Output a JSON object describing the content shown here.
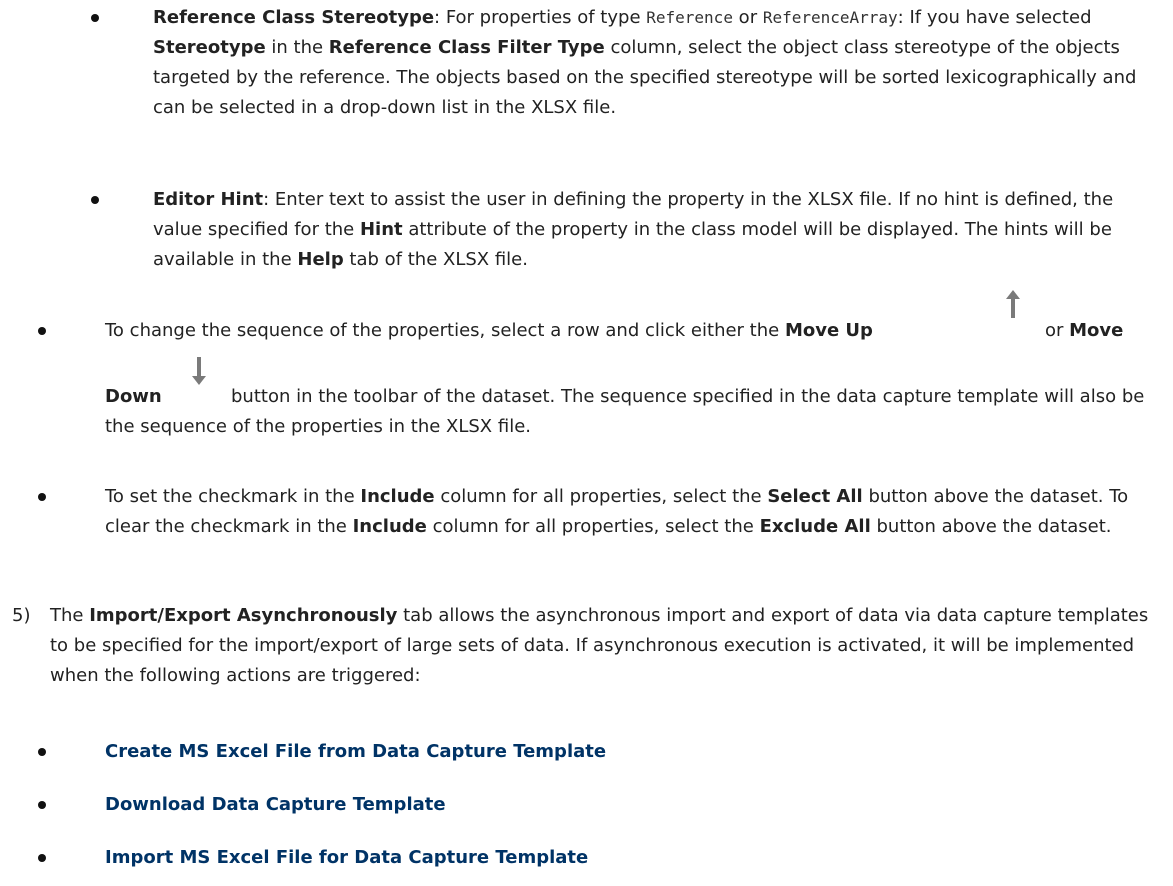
{
  "colors": {
    "accent": "#003366",
    "text": "#222222",
    "icon": "#7a7a7a"
  },
  "sub_bullets": [
    {
      "term": "Reference Class Stereotype",
      "t1": ": For properties of type ",
      "code1": "Reference",
      "t2": " or ",
      "code2": "ReferenceArray",
      "t3": ": If you have selected ",
      "b1": "Stereotype",
      "t4": " in the ",
      "b2": "Reference Class Filter Type",
      "t5": " column, select the object class stereotype of the objects targeted by the reference. The objects based on the specified stereotype will be sorted lexicographically and can be selected in a drop-down list in the XLSX file."
    },
    {
      "term": "Editor Hint",
      "t1": ": Enter text to assist the user in defining the property in the XLSX file. If no hint is defined, the value specified for the ",
      "b1": "Hint",
      "t2": " attribute of the property in the class model will be displayed. The hints will be available in the ",
      "b2": "Help",
      "t3": " tab of the XLSX file."
    }
  ],
  "sequence_bullet": {
    "t1": "To change the sequence of the properties, select a row and click either the ",
    "b1": "Move Up",
    "t2": "or ",
    "b2": "Move",
    "b3": "Down",
    "t3": "button in the toolbar of the dataset. The sequence specified in the data capture template will also be the sequence of the properties in the XLSX file.",
    "icon_up": "arrow-up-icon",
    "icon_down": "arrow-down-icon"
  },
  "include_bullet": {
    "t1": "To set the checkmark in the ",
    "b1": "Include",
    "t2": " column for all properties, select the ",
    "b2": "Select All",
    "t3": " button above the dataset. To clear the checkmark in the ",
    "b3": "Include",
    "t4": " column for all properties, select the ",
    "b4": "Exclude All",
    "t5": " button above the dataset."
  },
  "step5": {
    "number": "5)",
    "t1": "The ",
    "b1": "Import/Export Asynchronously",
    "t2": " tab allows the asynchronous import and export of data via data capture templates to be specified for the import/export of large sets of data. If asynchronous execution is activated, it will be implemented when the following actions are triggered:",
    "actions": [
      "Create MS Excel File from Data Capture Template",
      "Download Data Capture Template",
      "Import MS Excel File for Data Capture Template"
    ]
  }
}
